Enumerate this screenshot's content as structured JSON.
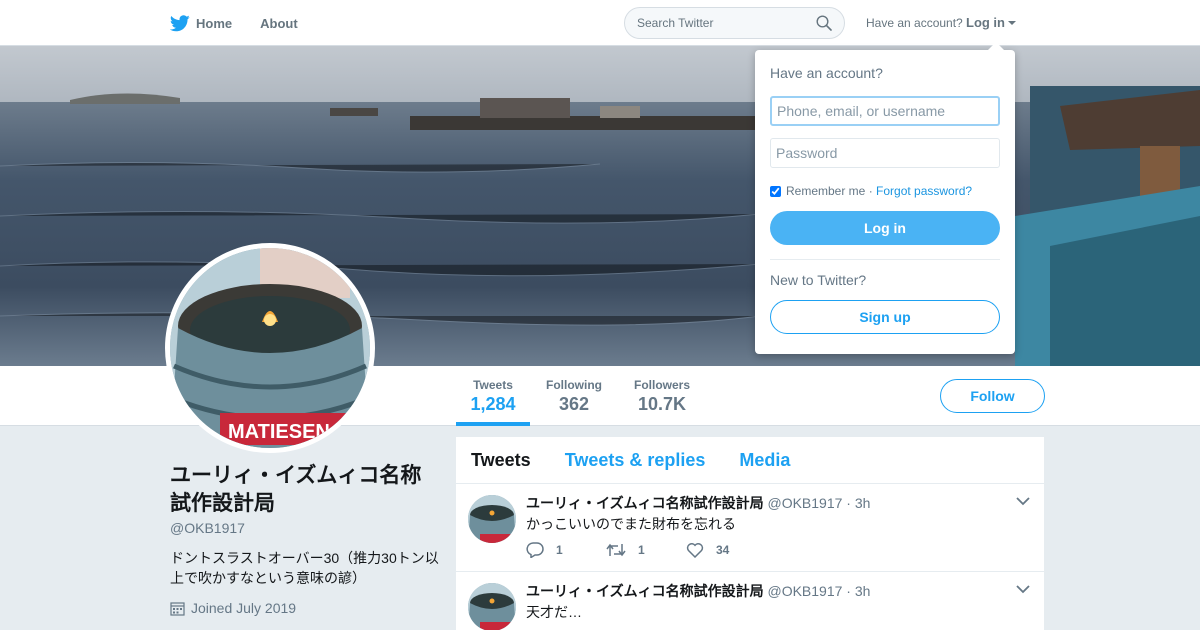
{
  "nav": {
    "home_label": "Home",
    "about_label": "About",
    "search_placeholder": "Search Twitter",
    "account_prompt": "Have an account?",
    "login_label": "Log in"
  },
  "colors": {
    "brand_blue": "#1da1f2",
    "background": "#e6ecf0"
  },
  "login_dropdown": {
    "title": "Have an account?",
    "username_placeholder": "Phone, email, or username",
    "password_placeholder": "Password",
    "remember_label": "Remember me",
    "separator": " · ",
    "forgot_label": "Forgot password?",
    "login_button": "Log in",
    "new_prompt": "New to Twitter?",
    "signup_button": "Sign up"
  },
  "profile": {
    "name": "ユーリィ・イズムィコ名称試作設計局",
    "handle": "@OKB1917",
    "bio": "ドントスラストオーバー30（推力30トン以上で吹かすなという意味の諺）",
    "joined": "Joined July 2019",
    "avatar_text": "MATIESEN",
    "follow_button": "Follow"
  },
  "stats": [
    {
      "label": "Tweets",
      "value": "1,284"
    },
    {
      "label": "Following",
      "value": "362"
    },
    {
      "label": "Followers",
      "value": "10.7K"
    }
  ],
  "timeline": {
    "tabs": [
      "Tweets",
      "Tweets & replies",
      "Media"
    ]
  },
  "tweets": [
    {
      "name": "ユーリィ・イズムィコ名称試作設計局",
      "handle": "@OKB1917",
      "time": "· 3h",
      "text": "かっこいいのでまた財布を忘れる",
      "replies": "1",
      "retweets": "1",
      "likes": "34"
    },
    {
      "name": "ユーリィ・イズムィコ名称試作設計局",
      "handle": "@OKB1917",
      "time": "· 3h",
      "text": "天才だ…"
    }
  ]
}
